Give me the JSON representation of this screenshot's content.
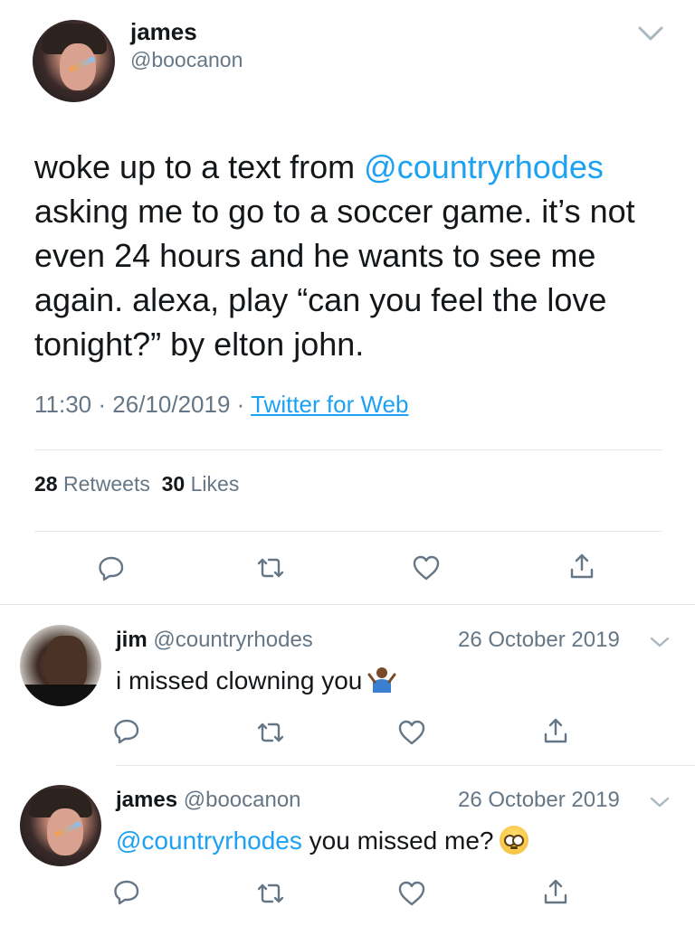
{
  "main_tweet": {
    "display_name": "james",
    "handle": "@boocanon",
    "text_parts": {
      "before_mention": "woke up to a text from ",
      "mention": "@countryrhodes",
      "after_mention": " asking me to go to a soccer game. it’s not even 24 hours and he wants to see me again. alexa, play “can you feel the love tonight?” by elton john."
    },
    "time": "11:30",
    "date": "26/10/2019",
    "separator": "·",
    "source": "Twitter for Web",
    "retweets_count": "28",
    "retweets_label": "Retweets",
    "likes_count": "30",
    "likes_label": "Likes"
  },
  "replies": [
    {
      "display_name": "jim",
      "handle": "@countryrhodes",
      "date": "26 October 2019",
      "text": "i missed clowning you",
      "emoji": "person-shrugging-emoji"
    },
    {
      "display_name": "james",
      "handle": "@boocanon",
      "date": "26 October 2019",
      "mention": "@countryrhodes",
      "text": " you missed me?",
      "emoji": "pleading-face-emoji"
    }
  ],
  "icons": {
    "reply": "reply-icon",
    "retweet": "retweet-icon",
    "like": "heart-icon",
    "share": "share-icon",
    "more": "chevron-down-icon"
  },
  "colors": {
    "accent": "#1da1f2",
    "secondary_text": "#657786",
    "primary_text": "#14171a",
    "divider": "#e1e8ed"
  }
}
